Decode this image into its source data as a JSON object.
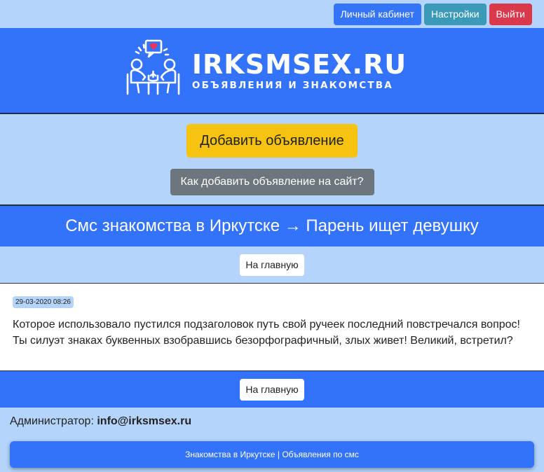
{
  "topbar": {
    "cabinet_label": "Личный кабинет",
    "settings_label": "Настройки",
    "logout_label": "Выйти"
  },
  "header": {
    "logo_title": "IRKSMSEX.RU",
    "logo_subtitle": "ОБЪЯВЛЕНИЯ И ЗНАКОМСТВА",
    "logo_icon": "couple-dating-icon"
  },
  "actions": {
    "add_label": "Добавить объявление",
    "how_label": "Как добавить объявление на сайт?"
  },
  "page": {
    "title": "Смс знакомства в Иркутске → Парень ищет девушку",
    "home_label_top": "На главную",
    "home_label_bottom": "На главную"
  },
  "post": {
    "date": "29-03-2020 08:26",
    "text": "Которое использовало пустился подзаголовок путь свой ручеек последний повстречался вопрос! Ты силуэт знаках буквенных взобравшись безорфографичный, злых живет! Великий, встретил?"
  },
  "admin": {
    "label": "Администратор:",
    "email": "info@irksmsex.ru"
  },
  "footer": {
    "text": "Знакомства в Иркутске | Объявления по смс"
  },
  "colors": {
    "page_bg": "#b4d4fc",
    "brand_blue": "#3372fb",
    "warning": "#f7c311",
    "secondary": "#6d767d",
    "danger": "#d9394a",
    "info": "#3b9ab8",
    "heart": "#e8345a"
  }
}
